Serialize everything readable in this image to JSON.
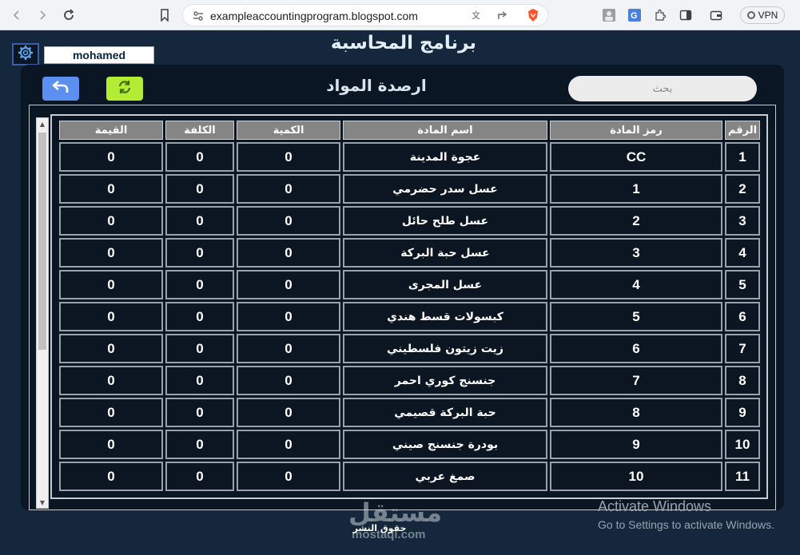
{
  "browser": {
    "url": "exampleaccountingprogram.blogspot.com",
    "vpn_label": "VPN"
  },
  "app": {
    "title": "برنامج المحاسبة",
    "username": "mohamed",
    "page_title": "ارصدة المواد",
    "search_placeholder": "بحث",
    "copyright": "حقوق النشر"
  },
  "table": {
    "headers": [
      "الرقم",
      "رمز المادة",
      "اسم المادة",
      "الكمية",
      "الكلفة",
      "القيمة"
    ],
    "rows": [
      [
        "1",
        "CC",
        "عجوة المدينة",
        "0",
        "0",
        "0"
      ],
      [
        "2",
        "1",
        "عسل سدر حضرمي",
        "0",
        "0",
        "0"
      ],
      [
        "3",
        "2",
        "عسل طلح حائل",
        "0",
        "0",
        "0"
      ],
      [
        "4",
        "3",
        "عسل حبة البركة",
        "0",
        "0",
        "0"
      ],
      [
        "5",
        "4",
        "عسل المجرى",
        "0",
        "0",
        "0"
      ],
      [
        "6",
        "5",
        "كبسولات قسط هندي",
        "0",
        "0",
        "0"
      ],
      [
        "7",
        "6",
        "زيت زيتون فلسطيني",
        "0",
        "0",
        "0"
      ],
      [
        "8",
        "7",
        "جنسنج كوري احمر",
        "0",
        "0",
        "0"
      ],
      [
        "9",
        "8",
        "حبة البركة قصيمي",
        "0",
        "0",
        "0"
      ],
      [
        "10",
        "9",
        "بودرة جنسنج صيني",
        "0",
        "0",
        "0"
      ],
      [
        "11",
        "10",
        "صمغ عربي",
        "0",
        "0",
        "0"
      ]
    ]
  },
  "watermark": {
    "logo": "مستقل",
    "url": "mostaql.com"
  },
  "os_notice": {
    "line1": "Activate Windows",
    "line2": "Go to Settings to activate Windows."
  },
  "colors": {
    "page_bg": "#14273c",
    "panel_bg": "#0a1624",
    "header_bg": "#858585",
    "back_button": "#5b8ff0",
    "refresh_button": "#b2ec35"
  },
  "icons": {
    "settings": "gear-icon",
    "back": "undo-arrow-icon",
    "refresh": "refresh-icon"
  }
}
